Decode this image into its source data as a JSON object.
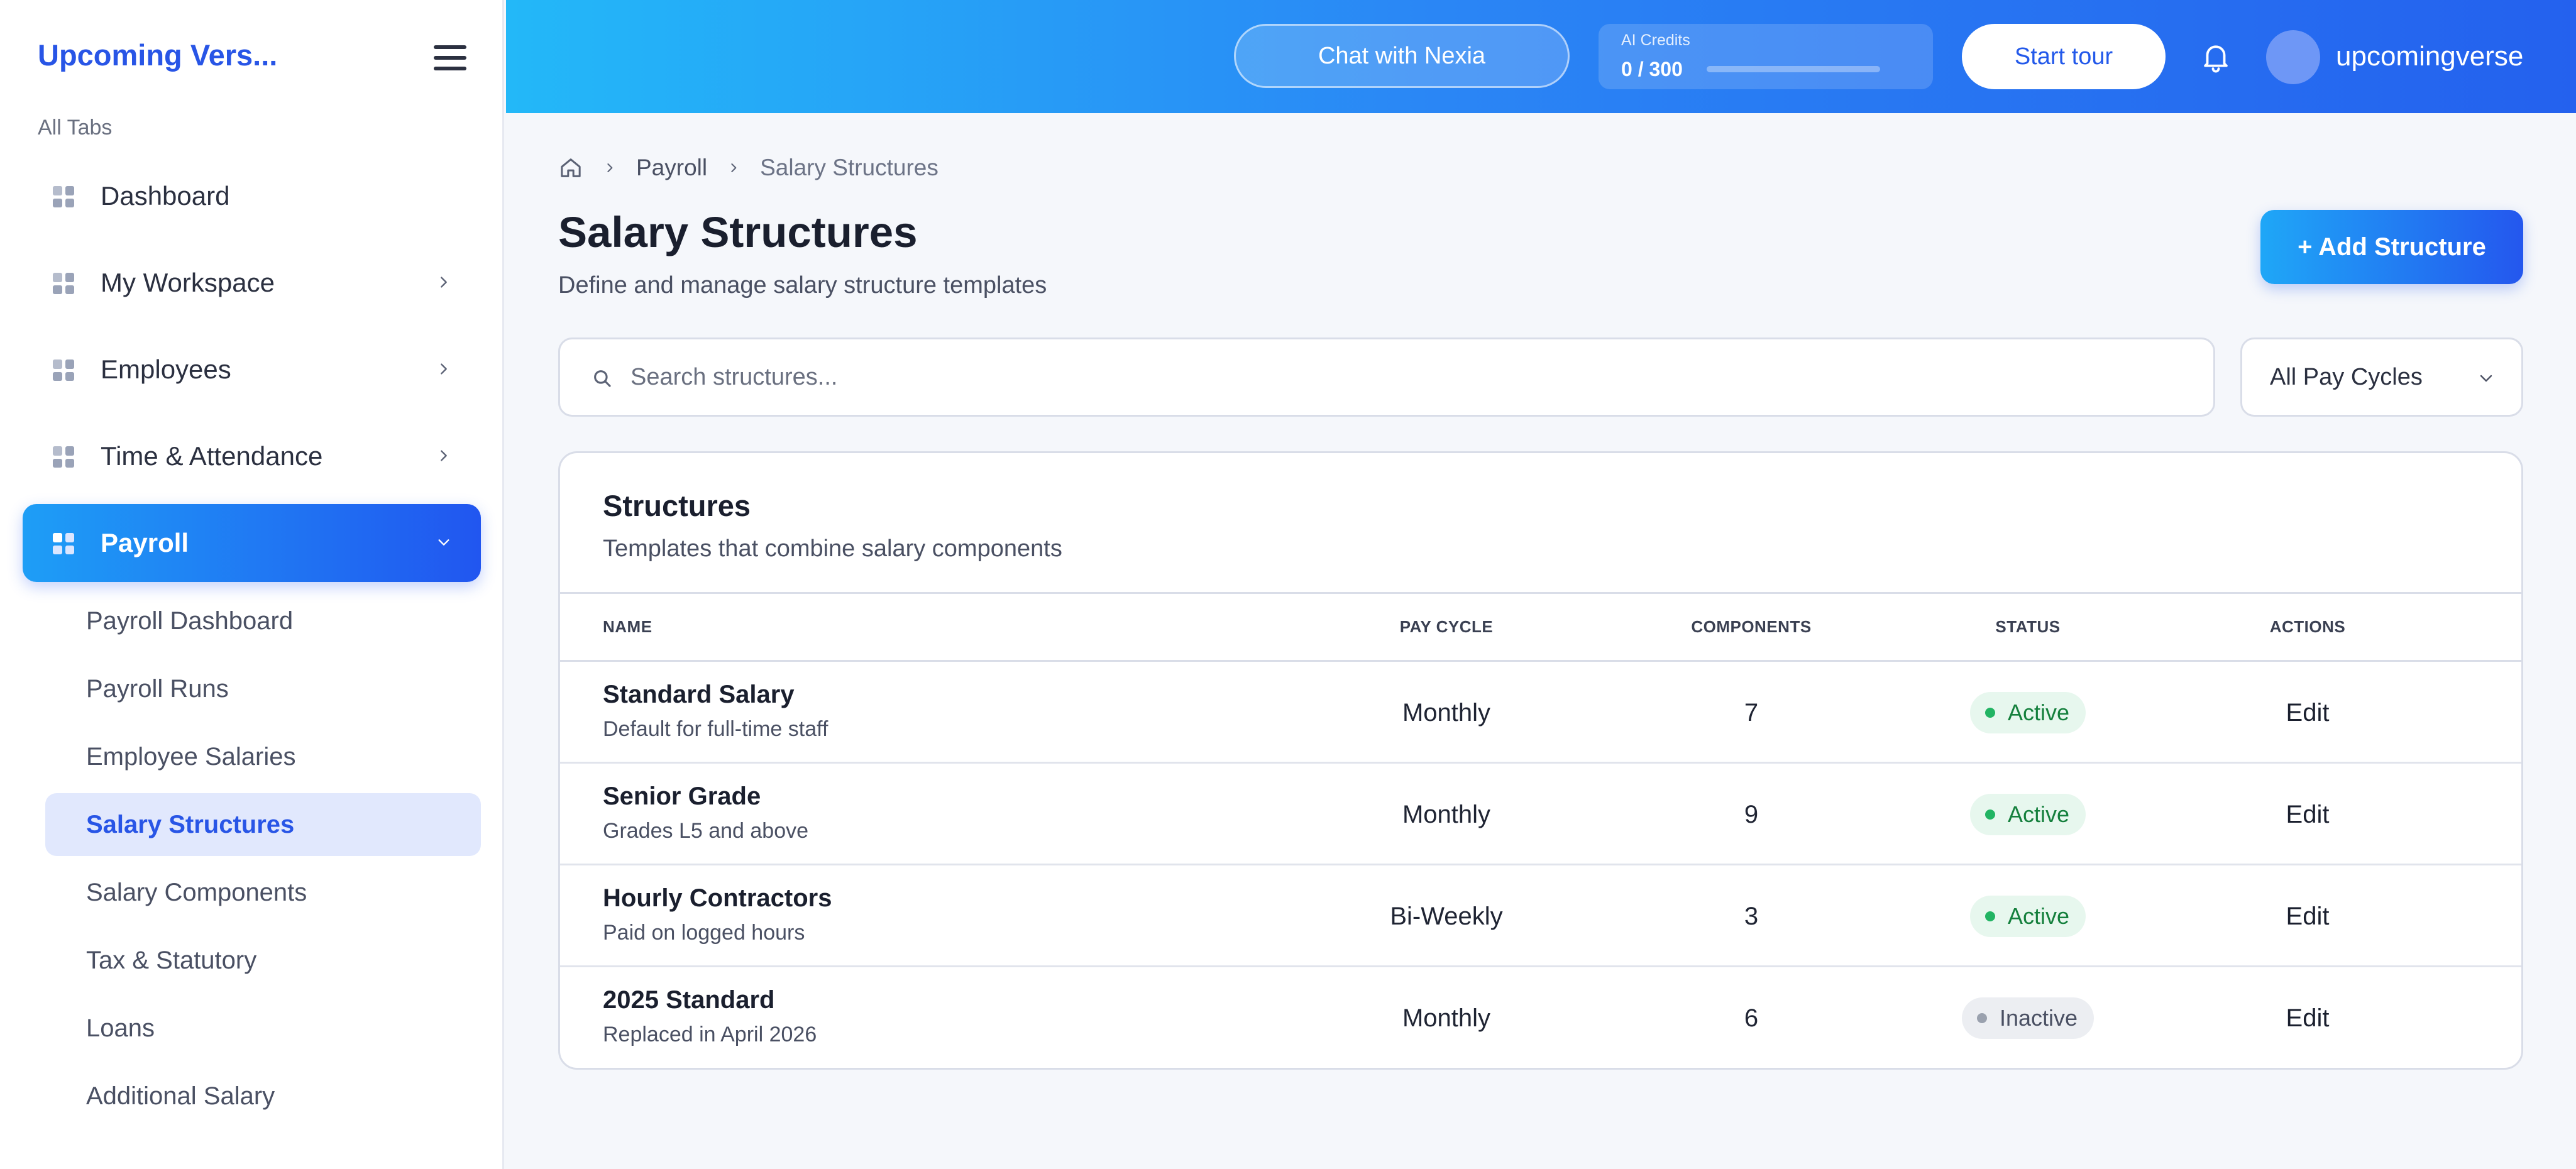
{
  "sidebar": {
    "brand": "Upcoming Vers...",
    "section_label": "All Tabs",
    "nav": [
      {
        "label": "Dashboard",
        "has_chevron": false
      },
      {
        "label": "My Workspace",
        "has_chevron": true
      },
      {
        "label": "Employees",
        "has_chevron": true
      },
      {
        "label": "Time & Attendance",
        "has_chevron": true
      },
      {
        "label": "Payroll",
        "has_chevron": true,
        "expanded": true,
        "active": true
      }
    ],
    "sub_items": [
      {
        "label": "Payroll Dashboard"
      },
      {
        "label": "Payroll Runs"
      },
      {
        "label": "Employee Salaries"
      },
      {
        "label": "Salary Structures",
        "selected": true
      },
      {
        "label": "Salary Components"
      },
      {
        "label": "Tax & Statutory"
      },
      {
        "label": "Loans"
      },
      {
        "label": "Additional Salary"
      }
    ]
  },
  "header": {
    "chat_button": "Chat with Nexia",
    "credits": {
      "label": "AI Credits",
      "value": "0 / 300",
      "used": 0,
      "total": 300
    },
    "tour_button": "Start tour",
    "username": "upcomingverse"
  },
  "breadcrumb": {
    "items": [
      "Payroll",
      "Salary Structures"
    ]
  },
  "page": {
    "title": "Salary Structures",
    "subtitle": "Define and manage salary structure templates",
    "add_button": "+ Add Structure"
  },
  "search": {
    "placeholder": "Search structures...",
    "value": ""
  },
  "filter": {
    "selected": "All Pay Cycles"
  },
  "card": {
    "title": "Structures",
    "subtitle": "Templates that combine salary components"
  },
  "table": {
    "columns": [
      "NAME",
      "PAY CYCLE",
      "COMPONENTS",
      "STATUS",
      "ACTIONS"
    ],
    "rows": [
      {
        "name": "Standard Salary",
        "desc": "Default for full-time staff",
        "cycle": "Monthly",
        "components": "7",
        "status": "Active",
        "action": "Edit"
      },
      {
        "name": "Senior Grade",
        "desc": "Grades L5 and above",
        "cycle": "Monthly",
        "components": "9",
        "status": "Active",
        "action": "Edit"
      },
      {
        "name": "Hourly Contractors",
        "desc": "Paid on logged hours",
        "cycle": "Bi-Weekly",
        "components": "3",
        "status": "Active",
        "action": "Edit"
      },
      {
        "name": "2025 Standard",
        "desc": "Replaced in April 2026",
        "cycle": "Monthly",
        "components": "6",
        "status": "Inactive",
        "action": "Edit"
      }
    ]
  },
  "colors": {
    "accent": "#2855e6",
    "header_gradient_start": "#23b8f8",
    "header_gradient_end": "#2461ee",
    "status_active": "#15803d",
    "status_inactive": "#4a5063"
  },
  "icons": {
    "menu": "hamburger-icon",
    "nav": "grid-icon",
    "expand": "chevron-icon",
    "notifications": "bell-icon",
    "home": "home-icon",
    "search": "search-icon",
    "filter": "chevron-down-icon"
  }
}
